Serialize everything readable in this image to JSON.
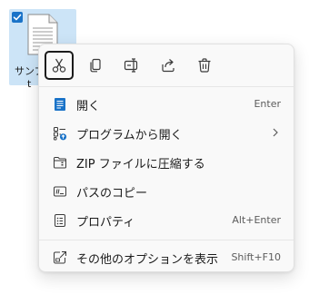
{
  "desktop": {
    "file": {
      "label_line1": "サンプ",
      "label_line2": "t",
      "selected": true
    }
  },
  "context_menu": {
    "toolbar": [
      {
        "name": "cut",
        "icon": "scissors-icon",
        "focused": true
      },
      {
        "name": "copy",
        "icon": "copy-icon",
        "focused": false
      },
      {
        "name": "rename",
        "icon": "rename-icon",
        "focused": false
      },
      {
        "name": "share",
        "icon": "share-icon",
        "focused": false
      },
      {
        "name": "delete",
        "icon": "trash-icon",
        "focused": false
      }
    ],
    "items": [
      {
        "label": "開く",
        "accelerator": "Enter",
        "icon": "open-icon"
      },
      {
        "label": "プログラムから開く",
        "accelerator": "",
        "icon": "open-with-icon",
        "submenu": true
      },
      {
        "label": "ZIP ファイルに圧縮する",
        "accelerator": "",
        "icon": "zip-folder-icon"
      },
      {
        "label": "パスのコピー",
        "accelerator": "",
        "icon": "copy-path-icon"
      },
      {
        "label": "プロパティ",
        "accelerator": "Alt+Enter",
        "icon": "properties-icon"
      }
    ],
    "footer_item": {
      "label": "その他のオプションを表示",
      "accelerator": "Shift+F10",
      "icon": "more-options-icon"
    },
    "colors": {
      "accent": "#1a73c8",
      "menu_bg": "#f9f9f9",
      "selection_bg": "#cce4f7"
    }
  }
}
